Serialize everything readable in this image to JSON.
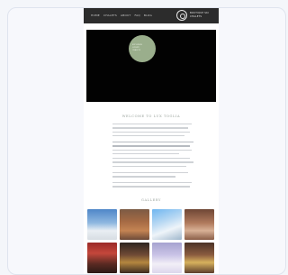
{
  "nav": {
    "items": [
      "HOME",
      "CHALETS",
      "ABOUT",
      "FAQ",
      "BLOG"
    ]
  },
  "brand": {
    "line1": "BOUTIQUE SKI",
    "line2": "CHALETS"
  },
  "badge": {
    "line1": "EXCLUSIVE",
    "line2": "LUXURY",
    "line3": "CHALETS"
  },
  "welcome": {
    "heading": "WELCOME TO LUX TOGLIA"
  },
  "gallery": {
    "heading": "GALLERY"
  },
  "colors": {
    "topbar": "#2c2c2c",
    "hero": "#020202",
    "badge": "#9aae8c",
    "heading_text": "#9aa39c"
  }
}
